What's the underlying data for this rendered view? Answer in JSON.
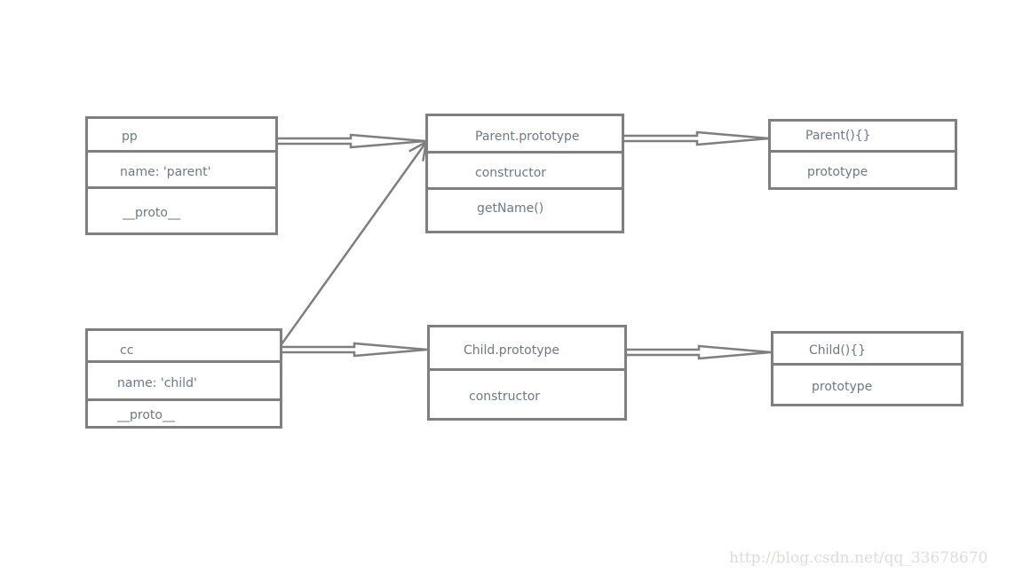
{
  "diagram": {
    "stroke_color": "#7f7f7f",
    "text_color": "#6f7886",
    "boxes": {
      "pp": {
        "title": "pp",
        "fields": [
          "name:  'parent'",
          "__proto__"
        ]
      },
      "parent_prototype": {
        "title": "Parent.prototype",
        "fields": [
          "constructor",
          "getName()"
        ]
      },
      "parent_fn": {
        "title": "Parent(){}",
        "fields": [
          "prototype"
        ]
      },
      "cc": {
        "title": "cc",
        "fields": [
          "name:  'child'",
          "__proto__"
        ]
      },
      "child_prototype": {
        "title": "Child.prototype",
        "fields": [
          "constructor"
        ]
      },
      "child_fn": {
        "title": "Child(){}",
        "fields": [
          "prototype"
        ]
      }
    },
    "arrows": [
      {
        "from": "pp",
        "to": "parent_prototype",
        "style": "double-hollow"
      },
      {
        "from": "parent_prototype",
        "to": "parent_fn",
        "style": "double-hollow"
      },
      {
        "from": "cc",
        "to": "child_prototype",
        "style": "double-hollow"
      },
      {
        "from": "child_prototype",
        "to": "child_fn",
        "style": "double-hollow"
      },
      {
        "from": "cc",
        "to": "parent_prototype",
        "style": "single-open"
      }
    ]
  },
  "watermark": "http://blog.csdn.net/qq_33678670"
}
